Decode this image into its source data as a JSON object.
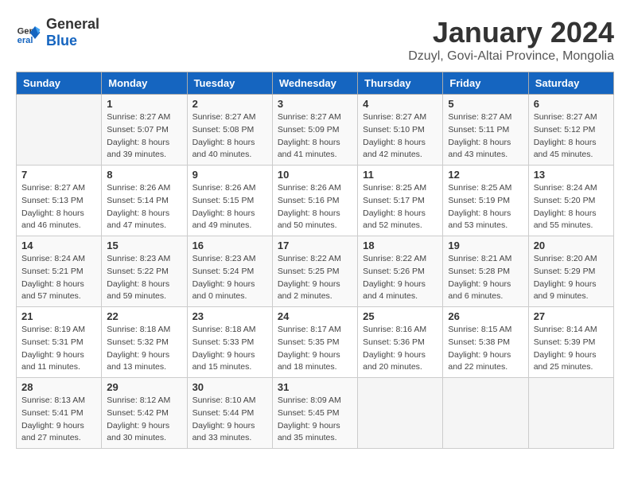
{
  "logo": {
    "general": "General",
    "blue": "Blue"
  },
  "title": "January 2024",
  "subtitle": "Dzuyl, Govi-Altai Province, Mongolia",
  "days_of_week": [
    "Sunday",
    "Monday",
    "Tuesday",
    "Wednesday",
    "Thursday",
    "Friday",
    "Saturday"
  ],
  "weeks": [
    [
      {
        "day": "",
        "sunrise": "",
        "sunset": "",
        "daylight": ""
      },
      {
        "day": "1",
        "sunrise": "Sunrise: 8:27 AM",
        "sunset": "Sunset: 5:07 PM",
        "daylight": "Daylight: 8 hours and 39 minutes."
      },
      {
        "day": "2",
        "sunrise": "Sunrise: 8:27 AM",
        "sunset": "Sunset: 5:08 PM",
        "daylight": "Daylight: 8 hours and 40 minutes."
      },
      {
        "day": "3",
        "sunrise": "Sunrise: 8:27 AM",
        "sunset": "Sunset: 5:09 PM",
        "daylight": "Daylight: 8 hours and 41 minutes."
      },
      {
        "day": "4",
        "sunrise": "Sunrise: 8:27 AM",
        "sunset": "Sunset: 5:10 PM",
        "daylight": "Daylight: 8 hours and 42 minutes."
      },
      {
        "day": "5",
        "sunrise": "Sunrise: 8:27 AM",
        "sunset": "Sunset: 5:11 PM",
        "daylight": "Daylight: 8 hours and 43 minutes."
      },
      {
        "day": "6",
        "sunrise": "Sunrise: 8:27 AM",
        "sunset": "Sunset: 5:12 PM",
        "daylight": "Daylight: 8 hours and 45 minutes."
      }
    ],
    [
      {
        "day": "7",
        "sunrise": "Sunrise: 8:27 AM",
        "sunset": "Sunset: 5:13 PM",
        "daylight": "Daylight: 8 hours and 46 minutes."
      },
      {
        "day": "8",
        "sunrise": "Sunrise: 8:26 AM",
        "sunset": "Sunset: 5:14 PM",
        "daylight": "Daylight: 8 hours and 47 minutes."
      },
      {
        "day": "9",
        "sunrise": "Sunrise: 8:26 AM",
        "sunset": "Sunset: 5:15 PM",
        "daylight": "Daylight: 8 hours and 49 minutes."
      },
      {
        "day": "10",
        "sunrise": "Sunrise: 8:26 AM",
        "sunset": "Sunset: 5:16 PM",
        "daylight": "Daylight: 8 hours and 50 minutes."
      },
      {
        "day": "11",
        "sunrise": "Sunrise: 8:25 AM",
        "sunset": "Sunset: 5:17 PM",
        "daylight": "Daylight: 8 hours and 52 minutes."
      },
      {
        "day": "12",
        "sunrise": "Sunrise: 8:25 AM",
        "sunset": "Sunset: 5:19 PM",
        "daylight": "Daylight: 8 hours and 53 minutes."
      },
      {
        "day": "13",
        "sunrise": "Sunrise: 8:24 AM",
        "sunset": "Sunset: 5:20 PM",
        "daylight": "Daylight: 8 hours and 55 minutes."
      }
    ],
    [
      {
        "day": "14",
        "sunrise": "Sunrise: 8:24 AM",
        "sunset": "Sunset: 5:21 PM",
        "daylight": "Daylight: 8 hours and 57 minutes."
      },
      {
        "day": "15",
        "sunrise": "Sunrise: 8:23 AM",
        "sunset": "Sunset: 5:22 PM",
        "daylight": "Daylight: 8 hours and 59 minutes."
      },
      {
        "day": "16",
        "sunrise": "Sunrise: 8:23 AM",
        "sunset": "Sunset: 5:24 PM",
        "daylight": "Daylight: 9 hours and 0 minutes."
      },
      {
        "day": "17",
        "sunrise": "Sunrise: 8:22 AM",
        "sunset": "Sunset: 5:25 PM",
        "daylight": "Daylight: 9 hours and 2 minutes."
      },
      {
        "day": "18",
        "sunrise": "Sunrise: 8:22 AM",
        "sunset": "Sunset: 5:26 PM",
        "daylight": "Daylight: 9 hours and 4 minutes."
      },
      {
        "day": "19",
        "sunrise": "Sunrise: 8:21 AM",
        "sunset": "Sunset: 5:28 PM",
        "daylight": "Daylight: 9 hours and 6 minutes."
      },
      {
        "day": "20",
        "sunrise": "Sunrise: 8:20 AM",
        "sunset": "Sunset: 5:29 PM",
        "daylight": "Daylight: 9 hours and 9 minutes."
      }
    ],
    [
      {
        "day": "21",
        "sunrise": "Sunrise: 8:19 AM",
        "sunset": "Sunset: 5:31 PM",
        "daylight": "Daylight: 9 hours and 11 minutes."
      },
      {
        "day": "22",
        "sunrise": "Sunrise: 8:18 AM",
        "sunset": "Sunset: 5:32 PM",
        "daylight": "Daylight: 9 hours and 13 minutes."
      },
      {
        "day": "23",
        "sunrise": "Sunrise: 8:18 AM",
        "sunset": "Sunset: 5:33 PM",
        "daylight": "Daylight: 9 hours and 15 minutes."
      },
      {
        "day": "24",
        "sunrise": "Sunrise: 8:17 AM",
        "sunset": "Sunset: 5:35 PM",
        "daylight": "Daylight: 9 hours and 18 minutes."
      },
      {
        "day": "25",
        "sunrise": "Sunrise: 8:16 AM",
        "sunset": "Sunset: 5:36 PM",
        "daylight": "Daylight: 9 hours and 20 minutes."
      },
      {
        "day": "26",
        "sunrise": "Sunrise: 8:15 AM",
        "sunset": "Sunset: 5:38 PM",
        "daylight": "Daylight: 9 hours and 22 minutes."
      },
      {
        "day": "27",
        "sunrise": "Sunrise: 8:14 AM",
        "sunset": "Sunset: 5:39 PM",
        "daylight": "Daylight: 9 hours and 25 minutes."
      }
    ],
    [
      {
        "day": "28",
        "sunrise": "Sunrise: 8:13 AM",
        "sunset": "Sunset: 5:41 PM",
        "daylight": "Daylight: 9 hours and 27 minutes."
      },
      {
        "day": "29",
        "sunrise": "Sunrise: 8:12 AM",
        "sunset": "Sunset: 5:42 PM",
        "daylight": "Daylight: 9 hours and 30 minutes."
      },
      {
        "day": "30",
        "sunrise": "Sunrise: 8:10 AM",
        "sunset": "Sunset: 5:44 PM",
        "daylight": "Daylight: 9 hours and 33 minutes."
      },
      {
        "day": "31",
        "sunrise": "Sunrise: 8:09 AM",
        "sunset": "Sunset: 5:45 PM",
        "daylight": "Daylight: 9 hours and 35 minutes."
      },
      {
        "day": "",
        "sunrise": "",
        "sunset": "",
        "daylight": ""
      },
      {
        "day": "",
        "sunrise": "",
        "sunset": "",
        "daylight": ""
      },
      {
        "day": "",
        "sunrise": "",
        "sunset": "",
        "daylight": ""
      }
    ]
  ]
}
